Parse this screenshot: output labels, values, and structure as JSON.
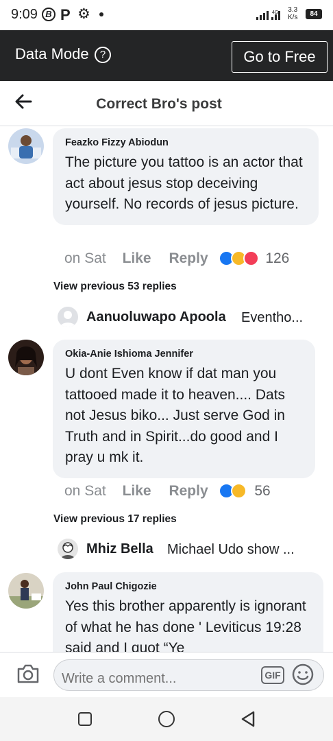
{
  "status_bar": {
    "time": "9:09",
    "b_icon_letter": "B",
    "p_icon_letter": "P",
    "network": "4G",
    "speed_value": "3.3",
    "speed_unit": "K/s",
    "battery": "84"
  },
  "data_bar": {
    "label": "Data Mode",
    "help_symbol": "?",
    "go_free_label": "Go to Free"
  },
  "header": {
    "title": "Correct Bro's post"
  },
  "comments": [
    {
      "author": "Feazko Fizzy Abiodun",
      "text": "The picture you tattoo is an actor that act about jesus stop deceiving yourself. No records of jesus picture.",
      "time": "on Sat",
      "like_label": "Like",
      "reply_label": "Reply",
      "reaction_icons": [
        "like",
        "haha",
        "love"
      ],
      "reaction_count": "126",
      "view_previous": "View previous 53 replies",
      "latest_reply": {
        "name": "Aanuoluwapo Apoola",
        "snippet": "Eventho..."
      }
    },
    {
      "author": "Okia-Anie Ishioma Jennifer",
      "text": "U dont Even know if dat man you tattooed made it to heaven.... Dats not Jesus biko... Just serve God in Truth and in Spirit...do good and I pray u mk it.",
      "time": "on Sat",
      "like_label": "Like",
      "reply_label": "Reply",
      "reaction_icons": [
        "like",
        "haha"
      ],
      "reaction_count": "56",
      "view_previous": "View previous 17 replies",
      "latest_reply": {
        "name": "Mhiz Bella",
        "snippet": "Michael Udo show ..."
      }
    },
    {
      "author": "John Paul Chigozie",
      "text": "Yes this brother apparently is ignorant of what he has done ' Leviticus 19:28 said and I quot “Ye"
    }
  ],
  "composer": {
    "placeholder": "Write a comment...",
    "gif_label": "GIF"
  },
  "colors": {
    "data_bar_bg": "#242526",
    "bubble_bg": "#f0f2f5",
    "like_blue": "#1877f2",
    "haha_yellow": "#f7b928",
    "love_red": "#f33e58"
  }
}
